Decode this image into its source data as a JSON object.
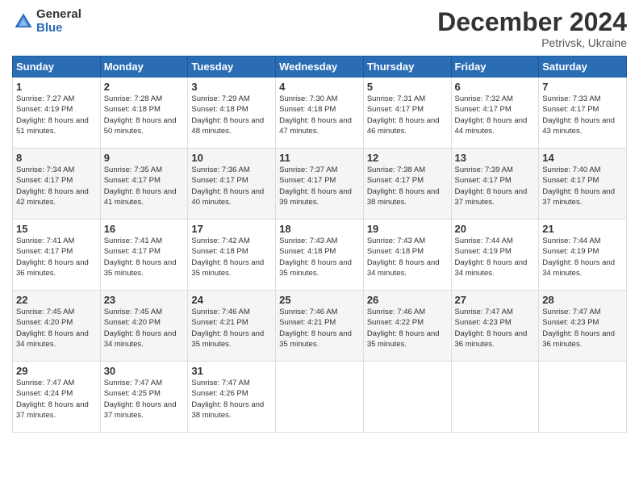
{
  "header": {
    "logo_general": "General",
    "logo_blue": "Blue",
    "month_title": "December 2024",
    "location": "Petrivsk, Ukraine"
  },
  "days_of_week": [
    "Sunday",
    "Monday",
    "Tuesday",
    "Wednesday",
    "Thursday",
    "Friday",
    "Saturday"
  ],
  "weeks": [
    [
      {
        "day": "1",
        "sunrise": "Sunrise: 7:27 AM",
        "sunset": "Sunset: 4:19 PM",
        "daylight": "Daylight: 8 hours and 51 minutes."
      },
      {
        "day": "2",
        "sunrise": "Sunrise: 7:28 AM",
        "sunset": "Sunset: 4:18 PM",
        "daylight": "Daylight: 8 hours and 50 minutes."
      },
      {
        "day": "3",
        "sunrise": "Sunrise: 7:29 AM",
        "sunset": "Sunset: 4:18 PM",
        "daylight": "Daylight: 8 hours and 48 minutes."
      },
      {
        "day": "4",
        "sunrise": "Sunrise: 7:30 AM",
        "sunset": "Sunset: 4:18 PM",
        "daylight": "Daylight: 8 hours and 47 minutes."
      },
      {
        "day": "5",
        "sunrise": "Sunrise: 7:31 AM",
        "sunset": "Sunset: 4:17 PM",
        "daylight": "Daylight: 8 hours and 46 minutes."
      },
      {
        "day": "6",
        "sunrise": "Sunrise: 7:32 AM",
        "sunset": "Sunset: 4:17 PM",
        "daylight": "Daylight: 8 hours and 44 minutes."
      },
      {
        "day": "7",
        "sunrise": "Sunrise: 7:33 AM",
        "sunset": "Sunset: 4:17 PM",
        "daylight": "Daylight: 8 hours and 43 minutes."
      }
    ],
    [
      {
        "day": "8",
        "sunrise": "Sunrise: 7:34 AM",
        "sunset": "Sunset: 4:17 PM",
        "daylight": "Daylight: 8 hours and 42 minutes."
      },
      {
        "day": "9",
        "sunrise": "Sunrise: 7:35 AM",
        "sunset": "Sunset: 4:17 PM",
        "daylight": "Daylight: 8 hours and 41 minutes."
      },
      {
        "day": "10",
        "sunrise": "Sunrise: 7:36 AM",
        "sunset": "Sunset: 4:17 PM",
        "daylight": "Daylight: 8 hours and 40 minutes."
      },
      {
        "day": "11",
        "sunrise": "Sunrise: 7:37 AM",
        "sunset": "Sunset: 4:17 PM",
        "daylight": "Daylight: 8 hours and 39 minutes."
      },
      {
        "day": "12",
        "sunrise": "Sunrise: 7:38 AM",
        "sunset": "Sunset: 4:17 PM",
        "daylight": "Daylight: 8 hours and 38 minutes."
      },
      {
        "day": "13",
        "sunrise": "Sunrise: 7:39 AM",
        "sunset": "Sunset: 4:17 PM",
        "daylight": "Daylight: 8 hours and 37 minutes."
      },
      {
        "day": "14",
        "sunrise": "Sunrise: 7:40 AM",
        "sunset": "Sunset: 4:17 PM",
        "daylight": "Daylight: 8 hours and 37 minutes."
      }
    ],
    [
      {
        "day": "15",
        "sunrise": "Sunrise: 7:41 AM",
        "sunset": "Sunset: 4:17 PM",
        "daylight": "Daylight: 8 hours and 36 minutes."
      },
      {
        "day": "16",
        "sunrise": "Sunrise: 7:41 AM",
        "sunset": "Sunset: 4:17 PM",
        "daylight": "Daylight: 8 hours and 35 minutes."
      },
      {
        "day": "17",
        "sunrise": "Sunrise: 7:42 AM",
        "sunset": "Sunset: 4:18 PM",
        "daylight": "Daylight: 8 hours and 35 minutes."
      },
      {
        "day": "18",
        "sunrise": "Sunrise: 7:43 AM",
        "sunset": "Sunset: 4:18 PM",
        "daylight": "Daylight: 8 hours and 35 minutes."
      },
      {
        "day": "19",
        "sunrise": "Sunrise: 7:43 AM",
        "sunset": "Sunset: 4:18 PM",
        "daylight": "Daylight: 8 hours and 34 minutes."
      },
      {
        "day": "20",
        "sunrise": "Sunrise: 7:44 AM",
        "sunset": "Sunset: 4:19 PM",
        "daylight": "Daylight: 8 hours and 34 minutes."
      },
      {
        "day": "21",
        "sunrise": "Sunrise: 7:44 AM",
        "sunset": "Sunset: 4:19 PM",
        "daylight": "Daylight: 8 hours and 34 minutes."
      }
    ],
    [
      {
        "day": "22",
        "sunrise": "Sunrise: 7:45 AM",
        "sunset": "Sunset: 4:20 PM",
        "daylight": "Daylight: 8 hours and 34 minutes."
      },
      {
        "day": "23",
        "sunrise": "Sunrise: 7:45 AM",
        "sunset": "Sunset: 4:20 PM",
        "daylight": "Daylight: 8 hours and 34 minutes."
      },
      {
        "day": "24",
        "sunrise": "Sunrise: 7:46 AM",
        "sunset": "Sunset: 4:21 PM",
        "daylight": "Daylight: 8 hours and 35 minutes."
      },
      {
        "day": "25",
        "sunrise": "Sunrise: 7:46 AM",
        "sunset": "Sunset: 4:21 PM",
        "daylight": "Daylight: 8 hours and 35 minutes."
      },
      {
        "day": "26",
        "sunrise": "Sunrise: 7:46 AM",
        "sunset": "Sunset: 4:22 PM",
        "daylight": "Daylight: 8 hours and 35 minutes."
      },
      {
        "day": "27",
        "sunrise": "Sunrise: 7:47 AM",
        "sunset": "Sunset: 4:23 PM",
        "daylight": "Daylight: 8 hours and 36 minutes."
      },
      {
        "day": "28",
        "sunrise": "Sunrise: 7:47 AM",
        "sunset": "Sunset: 4:23 PM",
        "daylight": "Daylight: 8 hours and 36 minutes."
      }
    ],
    [
      {
        "day": "29",
        "sunrise": "Sunrise: 7:47 AM",
        "sunset": "Sunset: 4:24 PM",
        "daylight": "Daylight: 8 hours and 37 minutes."
      },
      {
        "day": "30",
        "sunrise": "Sunrise: 7:47 AM",
        "sunset": "Sunset: 4:25 PM",
        "daylight": "Daylight: 8 hours and 37 minutes."
      },
      {
        "day": "31",
        "sunrise": "Sunrise: 7:47 AM",
        "sunset": "Sunset: 4:26 PM",
        "daylight": "Daylight: 8 hours and 38 minutes."
      },
      null,
      null,
      null,
      null
    ]
  ]
}
